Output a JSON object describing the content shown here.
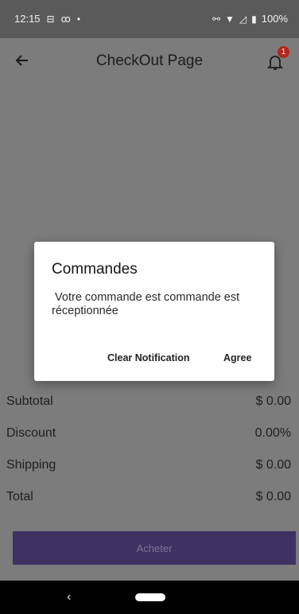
{
  "status_bar": {
    "time": "12:15",
    "left_icons": [
      "sim-icon",
      "voicemail-icon",
      "dot-icon"
    ],
    "right_icons": [
      "link-icon",
      "wifi-icon",
      "signal-icon",
      "battery-icon"
    ],
    "battery": "100%"
  },
  "app_bar": {
    "title": "CheckOut Page",
    "notification_count": "1"
  },
  "totals": [
    {
      "label": "Subtotal",
      "value": "$ 0.00"
    },
    {
      "label": "Discount",
      "value": "0.00%"
    },
    {
      "label": "Shipping",
      "value": "$ 0.00"
    },
    {
      "label": "Total",
      "value": "$ 0.00"
    }
  ],
  "buy_button": {
    "label": "Acheter"
  },
  "dialog": {
    "title": "Commandes",
    "body": " Votre commande est commande est réceptionnée",
    "clear_label": "Clear Notification",
    "agree_label": "Agree"
  },
  "colors": {
    "scrim_background": "#7c7c7c",
    "status_bar": "#5a5a5a",
    "buy_button": "#3e3163",
    "badge": "#b3261e"
  }
}
